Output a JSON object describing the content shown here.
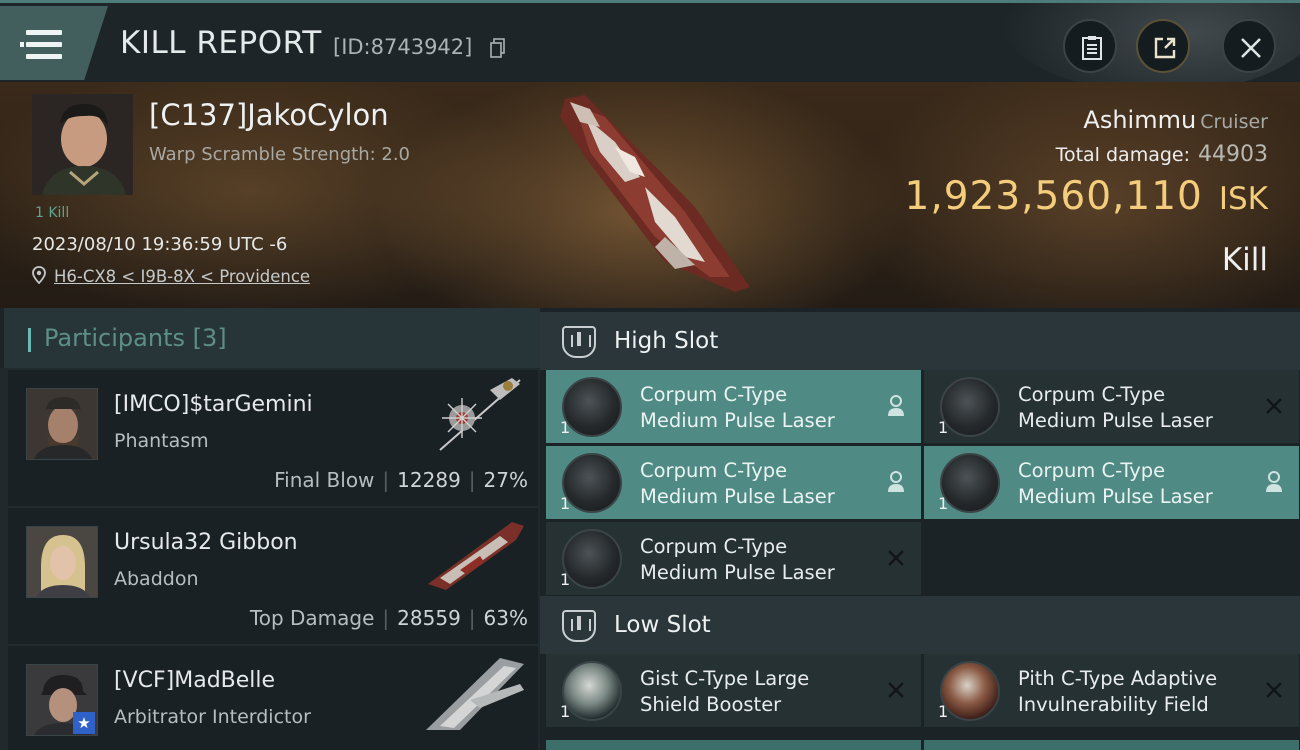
{
  "header": {
    "title": "KILL REPORT",
    "report_id": "[ID:8743942]"
  },
  "victim": {
    "name": "[C137]JakoCylon",
    "subtitle": "Warp Scramble Strength: 2.0",
    "kill_count": "1 Kill",
    "date": "2023/08/10 19:36:59 UTC -6",
    "location": "H6-CX8 < I9B-8X < Providence",
    "ship_name": "Ashimmu",
    "ship_class": "Cruiser",
    "total_damage_label": "Total damage:",
    "total_damage": "44903",
    "isk_value": "1,923,560,110",
    "isk_unit": "ISK",
    "result": "Kill"
  },
  "participants": {
    "title": "Participants [3]",
    "items": [
      {
        "name": "[IMCO]$tarGemini",
        "ship": "Phantasm",
        "label": "Final Blow",
        "damage": "12289",
        "percent": "27%"
      },
      {
        "name": "Ursula32 Gibbon",
        "ship": "Abaddon",
        "label": "Top Damage",
        "damage": "28559",
        "percent": "63%"
      },
      {
        "name": "[VCF]MadBelle",
        "ship": "Arbitrator Interdictor",
        "label": "",
        "damage": "",
        "percent": ""
      }
    ]
  },
  "fitting": {
    "high_slot": {
      "label": "High Slot",
      "modules": [
        {
          "line1": "Corpum C-Type",
          "line2": "Medium Pulse Laser",
          "qty": "1",
          "status": "fitted"
        },
        {
          "line1": "Corpum C-Type",
          "line2": "Medium Pulse Laser",
          "qty": "1",
          "status": "destroyed"
        },
        {
          "line1": "Corpum C-Type",
          "line2": "Medium Pulse Laser",
          "qty": "1",
          "status": "fitted"
        },
        {
          "line1": "Corpum C-Type",
          "line2": "Medium Pulse Laser",
          "qty": "1",
          "status": "fitted"
        },
        {
          "line1": "Corpum C-Type",
          "line2": "Medium Pulse Laser",
          "qty": "1",
          "status": "destroyed"
        }
      ]
    },
    "low_slot": {
      "label": "Low Slot",
      "modules": [
        {
          "line1": "Gist C-Type Large",
          "line2": "Shield Booster",
          "qty": "1",
          "status": "destroyed"
        },
        {
          "line1": "Pith C-Type Adaptive",
          "line2": "Invulnerability Field",
          "qty": "1",
          "status": "destroyed"
        }
      ]
    }
  },
  "icons": {
    "menu": "hamburger-menu-icon",
    "copy": "copy-icon",
    "clipboard": "clipboard-icon",
    "share": "share-icon",
    "close": "close-icon",
    "location": "location-pin-icon",
    "slot": "slot-icon",
    "dropped": "person-icon",
    "destroyed": "x-icon"
  },
  "colors": {
    "accent_teal": "#4f8b84",
    "isk_gold": "#f3cd7c",
    "kill_green": "#5ea58d",
    "star_blue": "#2f62c8"
  }
}
